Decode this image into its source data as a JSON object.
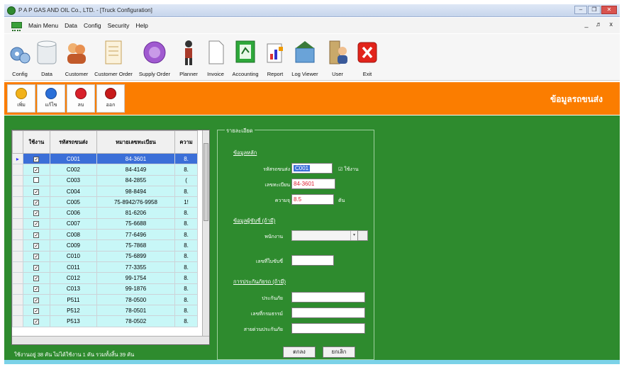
{
  "window": {
    "title": "P A P GAS AND OIL Co., LTD. - [Truck Configuration]"
  },
  "menu": [
    "Main Menu",
    "Data",
    "Config",
    "Security",
    "Help"
  ],
  "mdi_controls": "_ ♬ x",
  "toolbar": [
    {
      "label": "Config",
      "icon": "gears-icon"
    },
    {
      "label": "Data",
      "icon": "database-icon"
    },
    {
      "label": "Customer",
      "icon": "customers-icon"
    },
    {
      "label": "Customer Order",
      "icon": "order-form-icon"
    },
    {
      "label": "Supply Order",
      "icon": "supply-order-icon"
    },
    {
      "label": "Planner",
      "icon": "planner-person-icon"
    },
    {
      "label": "Invoice",
      "icon": "invoice-document-icon"
    },
    {
      "label": "Accounting",
      "icon": "accounting-book-icon"
    },
    {
      "label": "Report",
      "icon": "report-chart-icon"
    },
    {
      "label": "Log Viewer",
      "icon": "log-viewer-icon"
    },
    {
      "label": "User",
      "icon": "user-icon"
    },
    {
      "label": "Exit",
      "icon": "exit-x-icon"
    }
  ],
  "subtoolbar": [
    {
      "label": "เพิ่ม",
      "icon": "add-icon"
    },
    {
      "label": "แก้ไข",
      "icon": "edit-icon"
    },
    {
      "label": "ลบ",
      "icon": "delete-icon"
    },
    {
      "label": "ออก",
      "icon": "close-icon"
    }
  ],
  "section_heading": "ข้อมูลรถขนส่ง",
  "grid": {
    "columns": [
      "ใช้งาน",
      "รหัสรถขนส่ง",
      "หมายเลขทะเบียน",
      "ความ"
    ],
    "rows": [
      {
        "active": true,
        "code": "C001",
        "plate": "84-3601",
        "cap": "8.",
        "selected": true
      },
      {
        "active": true,
        "code": "C002",
        "plate": "84-4149",
        "cap": "8."
      },
      {
        "active": false,
        "code": "C003",
        "plate": "84-2855",
        "cap": "("
      },
      {
        "active": true,
        "code": "C004",
        "plate": "98-8494",
        "cap": "8."
      },
      {
        "active": true,
        "code": "C005",
        "plate": "75-8942/76-9958",
        "cap": "1!"
      },
      {
        "active": true,
        "code": "C006",
        "plate": "81-6206",
        "cap": "8."
      },
      {
        "active": true,
        "code": "C007",
        "plate": "75-6688",
        "cap": "8."
      },
      {
        "active": true,
        "code": "C008",
        "plate": "77-6496",
        "cap": "8."
      },
      {
        "active": true,
        "code": "C009",
        "plate": "75-7868",
        "cap": "8."
      },
      {
        "active": true,
        "code": "C010",
        "plate": "75-6899",
        "cap": "8."
      },
      {
        "active": true,
        "code": "C011",
        "plate": "77-3355",
        "cap": "8."
      },
      {
        "active": true,
        "code": "C012",
        "plate": "99-1754",
        "cap": "8."
      },
      {
        "active": true,
        "code": "C013",
        "plate": "99-1876",
        "cap": "8."
      },
      {
        "active": true,
        "code": "P511",
        "plate": "78-0500",
        "cap": "8."
      },
      {
        "active": true,
        "code": "P512",
        "plate": "78-0501",
        "cap": "8."
      },
      {
        "active": true,
        "code": "P513",
        "plate": "78-0502",
        "cap": "8."
      }
    ]
  },
  "status_text": "ใช้งานอยู่ 38 คัน ไม่ได้ใช้งาน 1 คัน รวมทั้งสิ้น 39 คัน",
  "detail": {
    "legend": "รายละเอียด",
    "sec_general": "ข้อมูลหลัก",
    "lbl_code": "รหัสรถขนส่ง",
    "code_value": "C001",
    "chk_active_label": "ใช้งาน",
    "lbl_plate": "เลขทะเบียน",
    "plate_value": "84-3601",
    "lbl_capacity": "ความจุ",
    "capacity_value": "8.5",
    "capacity_unit": "ตัน",
    "sec_owner": "ข้อมูลผู้ขับขี่ (ถ้ามี)",
    "lbl_driver": "พนักงาน",
    "lbl_license": "เลขที่ใบขับขี่",
    "sec_insurance": "การประกันภัยรถ (ถ้ามี)",
    "lbl_insurer": "ประกันภัย",
    "lbl_policy": "เลขที่กรมธรรม์",
    "lbl_agent": "สายด่วนประกันภัย",
    "btn_save": "ตกลง",
    "btn_cancel": "ยกเลิก"
  }
}
